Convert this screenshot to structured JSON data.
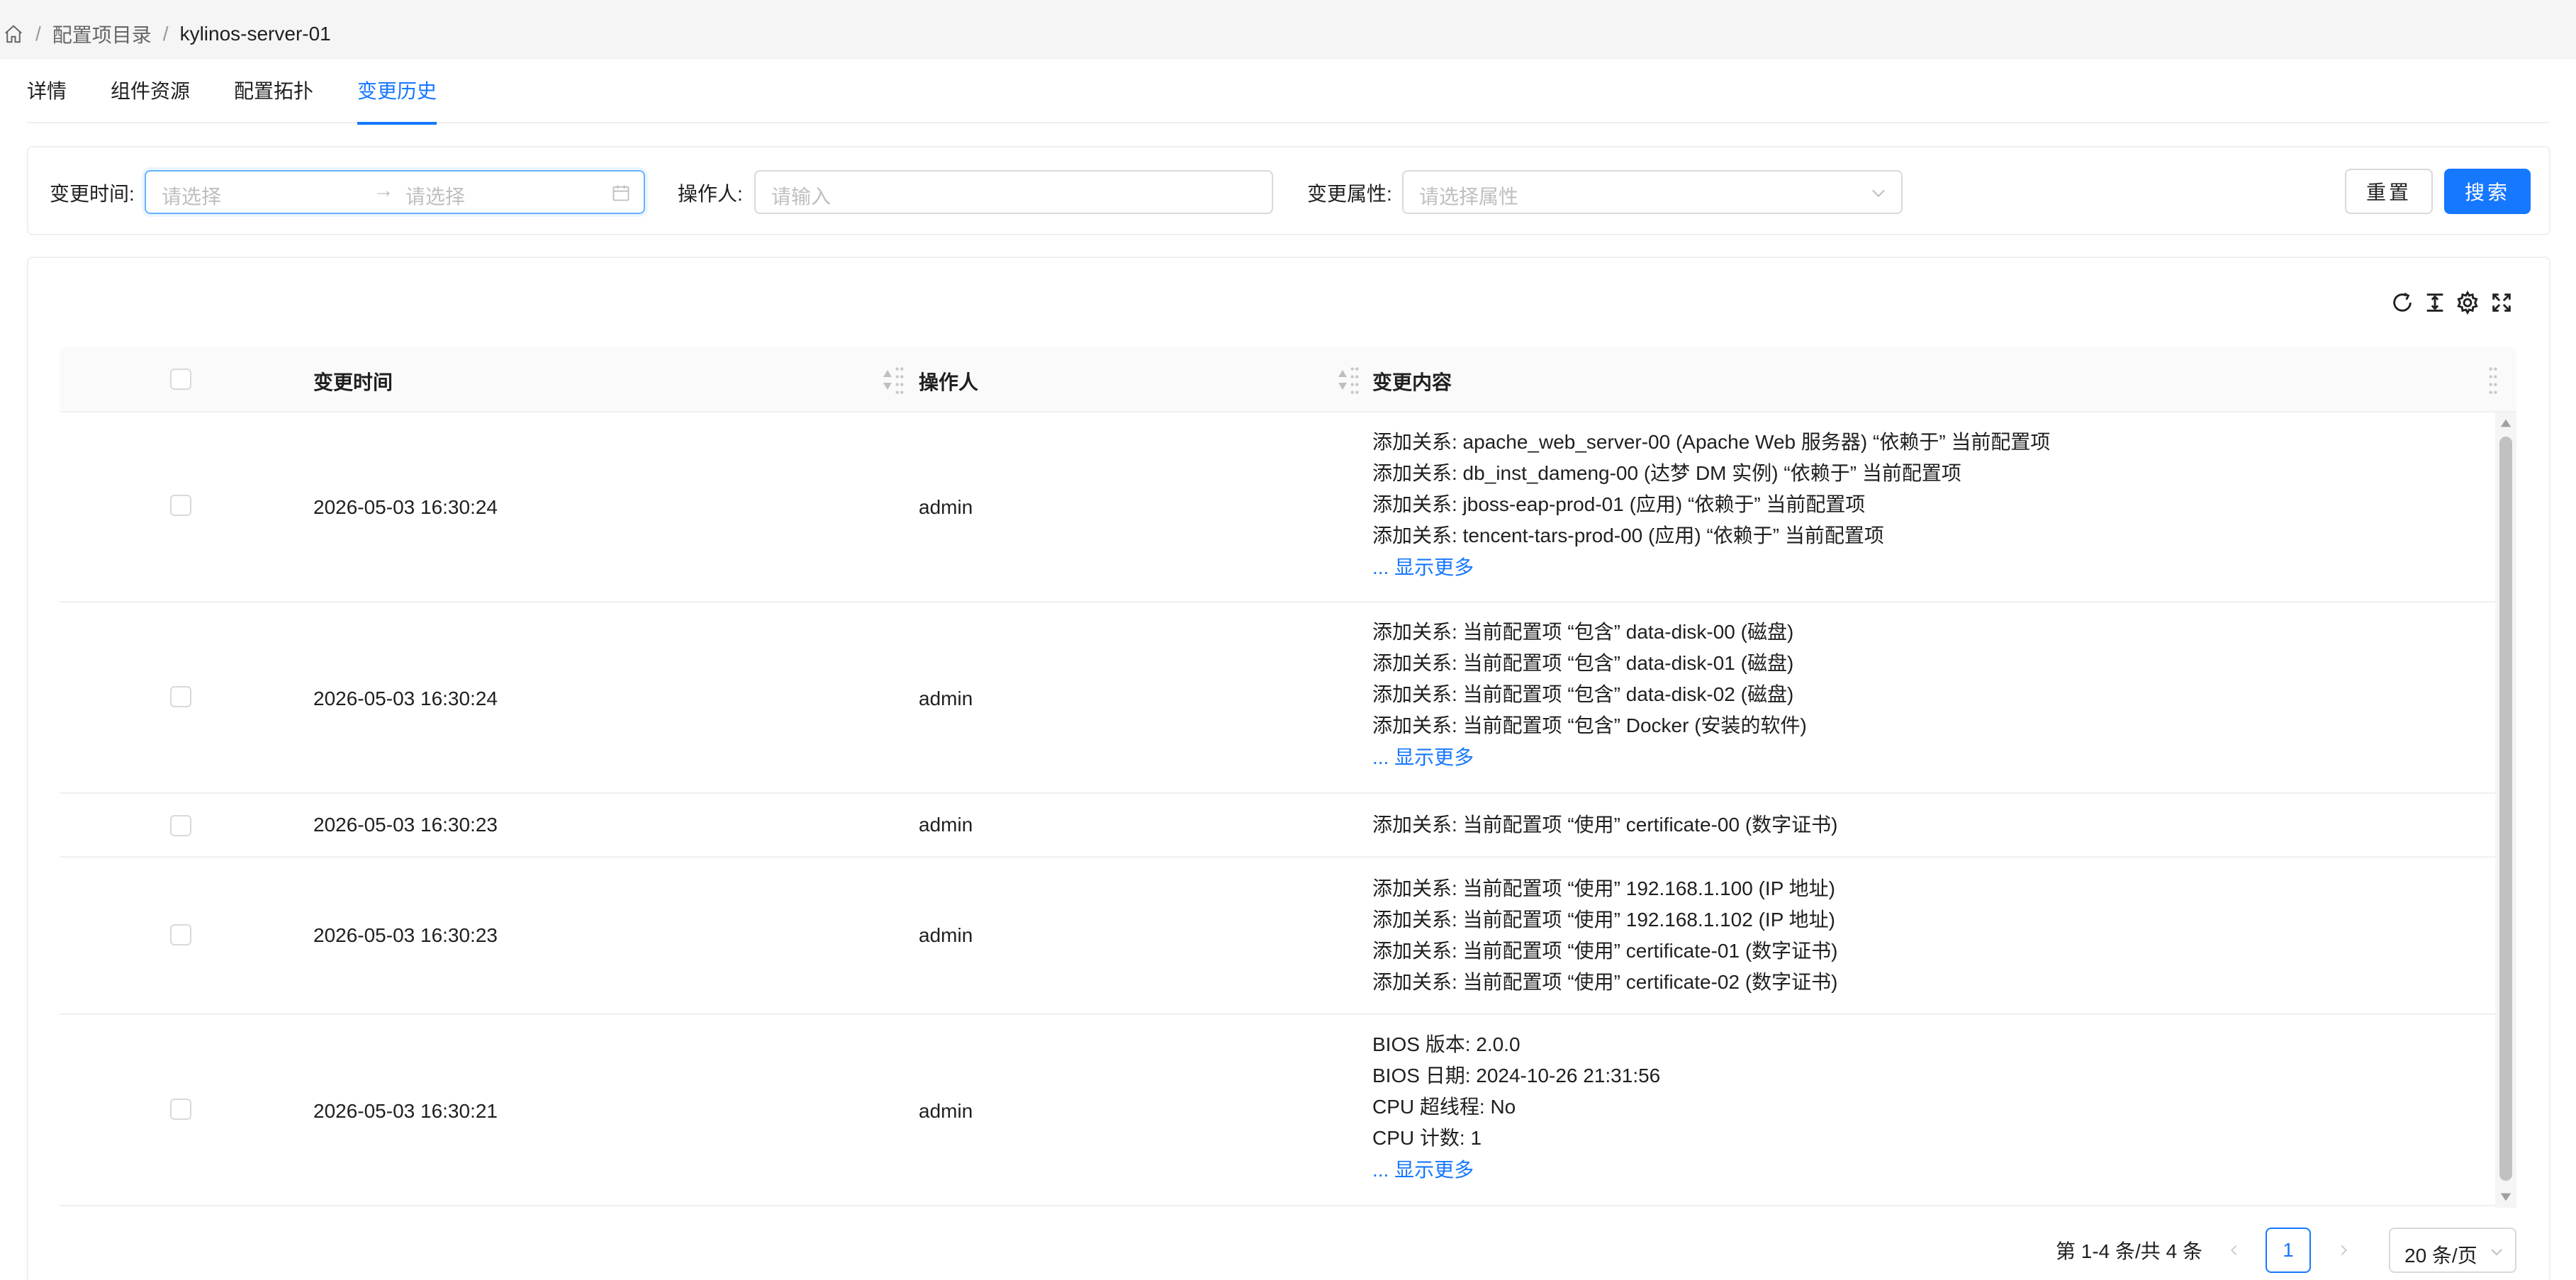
{
  "breadcrumb": {
    "items": [
      "配置项目录",
      "kylinos-server-01"
    ],
    "separator": "/"
  },
  "tabs": [
    {
      "label": "详情",
      "active": false
    },
    {
      "label": "组件资源",
      "active": false
    },
    {
      "label": "配置拓扑",
      "active": false
    },
    {
      "label": "变更历史",
      "active": true
    }
  ],
  "filter": {
    "time_label": "变更时间:",
    "time_start_placeholder": "请选择",
    "time_end_placeholder": "请选择",
    "operator_label": "操作人:",
    "operator_placeholder": "请输入",
    "attr_label": "变更属性:",
    "attr_placeholder": "请选择属性",
    "reset_label": "重置",
    "search_label": "搜索"
  },
  "table": {
    "columns": [
      "变更时间",
      "操作人",
      "变更内容"
    ],
    "show_more_label": "... 显示更多",
    "rows": [
      {
        "time": "2026-05-03 16:30:24",
        "operator": "admin",
        "changes": [
          "添加关系: apache_web_server-00 (Apache Web 服务器) “依赖于” 当前配置项",
          "添加关系: db_inst_dameng-00 (达梦 DM 实例) “依赖于” 当前配置项",
          "添加关系: jboss-eap-prod-01 (应用) “依赖于” 当前配置项",
          "添加关系: tencent-tars-prod-00 (应用) “依赖于” 当前配置项"
        ],
        "has_more": true
      },
      {
        "time": "2026-05-03 16:30:24",
        "operator": "admin",
        "changes": [
          "添加关系: 当前配置项 “包含” data-disk-00 (磁盘)",
          "添加关系: 当前配置项 “包含” data-disk-01 (磁盘)",
          "添加关系: 当前配置项 “包含” data-disk-02 (磁盘)",
          "添加关系: 当前配置项 “包含” Docker (安装的软件)"
        ],
        "has_more": true
      },
      {
        "time": "2026-05-03 16:30:23",
        "operator": "admin",
        "changes": [
          "添加关系: 当前配置项 “使用” certificate-00 (数字证书)"
        ],
        "has_more": false
      },
      {
        "time": "2026-05-03 16:30:23",
        "operator": "admin",
        "changes": [
          "添加关系: 当前配置项 “使用” 192.168.1.100 (IP 地址)",
          "添加关系: 当前配置项 “使用” 192.168.1.102 (IP 地址)",
          "添加关系: 当前配置项 “使用” certificate-01 (数字证书)",
          "添加关系: 当前配置项 “使用” certificate-02 (数字证书)"
        ],
        "has_more": false
      },
      {
        "time": "2026-05-03 16:30:21",
        "operator": "admin",
        "changes": [
          "BIOS 版本: 2.0.0",
          "BIOS 日期: 2024-10-26 21:31:56",
          "CPU 超线程: No",
          "CPU 计数: 1"
        ],
        "has_more": true
      }
    ]
  },
  "pagination": {
    "total_text": "第 1-4 条/共 4 条",
    "current_page": "1",
    "page_size": "20 条/页"
  },
  "colors": {
    "primary": "#1677ff",
    "border": "#f0f0f0",
    "placeholder": "#bfbfbf"
  }
}
